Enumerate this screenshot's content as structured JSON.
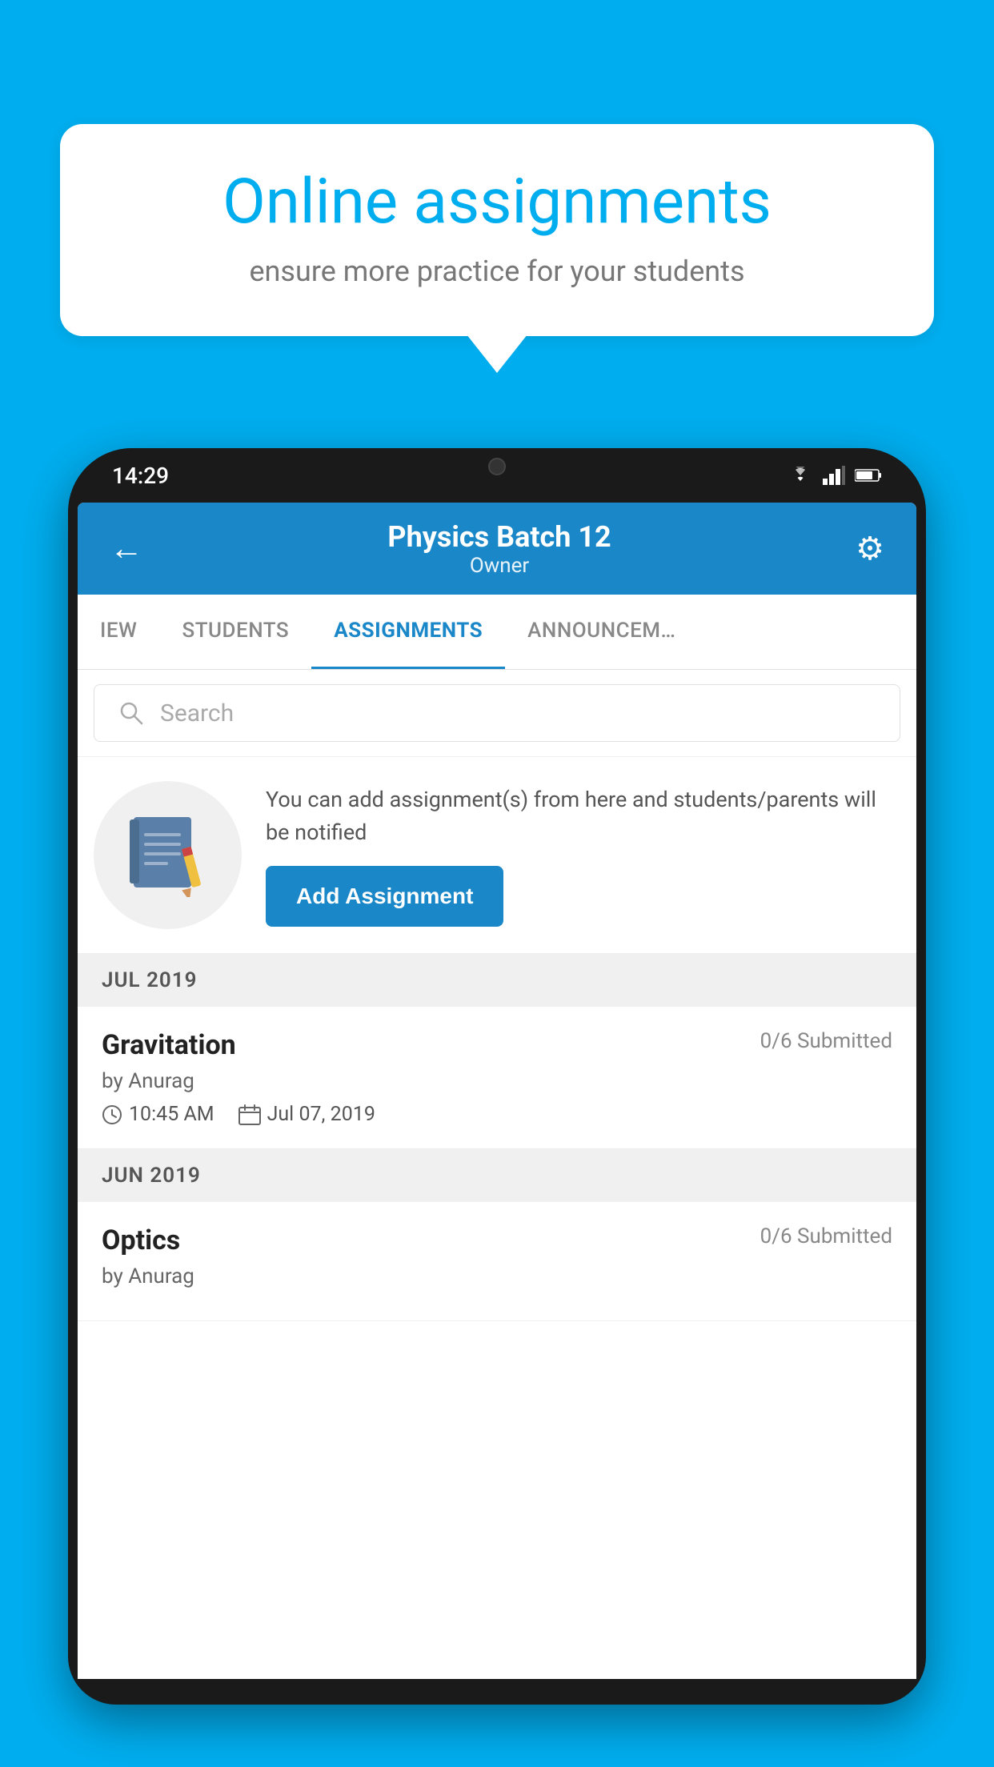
{
  "background_color": "#00AEEF",
  "speech_bubble": {
    "title": "Online assignments",
    "subtitle": "ensure more practice for your students"
  },
  "phone": {
    "status_bar": {
      "time": "14:29"
    },
    "header": {
      "title": "Physics Batch 12",
      "subtitle": "Owner",
      "back_label": "←",
      "settings_label": "⚙"
    },
    "tabs": [
      {
        "label": "IEW",
        "active": false
      },
      {
        "label": "STUDENTS",
        "active": false
      },
      {
        "label": "ASSIGNMENTS",
        "active": true
      },
      {
        "label": "ANNOUNCEM…",
        "active": false
      }
    ],
    "search": {
      "placeholder": "Search"
    },
    "add_assignment_section": {
      "description": "You can add assignment(s) from here and students/parents will be notified",
      "button_label": "Add Assignment"
    },
    "sections": [
      {
        "month_label": "JUL 2019",
        "assignments": [
          {
            "name": "Gravitation",
            "submitted": "0/6 Submitted",
            "by": "by Anurag",
            "time": "10:45 AM",
            "date": "Jul 07, 2019"
          }
        ]
      },
      {
        "month_label": "JUN 2019",
        "assignments": [
          {
            "name": "Optics",
            "submitted": "0/6 Submitted",
            "by": "by Anurag",
            "time": "",
            "date": ""
          }
        ]
      }
    ]
  }
}
